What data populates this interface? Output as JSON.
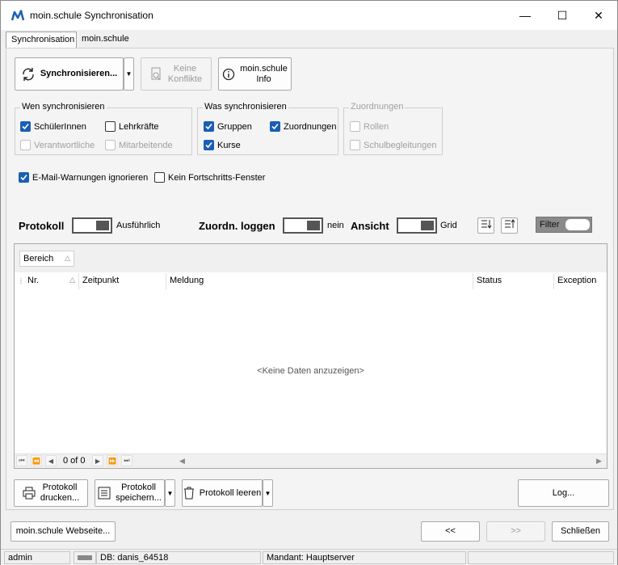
{
  "window": {
    "title": "moin.schule Synchronisation",
    "minimize_glyph": "—",
    "maximize_glyph": "☐",
    "close_glyph": "✕"
  },
  "tabs": [
    {
      "label": "Synchronisation",
      "active": true
    },
    {
      "label": "moin.schule",
      "active": false
    }
  ],
  "toolbar": {
    "sync_label": "Synchronisieren...",
    "conflicts_line1": "Keine",
    "conflicts_line2": "Konflikte",
    "info_line1": "moin.schule",
    "info_line2": "Info"
  },
  "groups": {
    "wen": {
      "title": "Wen synchronisieren",
      "items": [
        {
          "label": "SchülerInnen",
          "checked": true,
          "enabled": true
        },
        {
          "label": "Lehrkräfte",
          "checked": false,
          "enabled": true
        },
        {
          "label": "Verantwortliche",
          "checked": false,
          "enabled": false
        },
        {
          "label": "Mitarbeitende",
          "checked": false,
          "enabled": false
        }
      ]
    },
    "was": {
      "title": "Was synchronisieren",
      "items": [
        {
          "label": "Gruppen",
          "checked": true,
          "enabled": true
        },
        {
          "label": "Zuordnungen",
          "checked": true,
          "enabled": true
        },
        {
          "label": "Kurse",
          "checked": true,
          "enabled": true
        }
      ]
    },
    "zuordnungen": {
      "title": "Zuordnungen",
      "items": [
        {
          "label": "Rollen",
          "checked": false,
          "enabled": false
        },
        {
          "label": "Schulbegleitungen",
          "checked": false,
          "enabled": false
        }
      ]
    }
  },
  "options": {
    "ignore_email_warnings": {
      "label": "E-Mail-Warnungen ignorieren",
      "checked": true
    },
    "no_progress_window": {
      "label": "Kein Fortschritts-Fenster",
      "checked": false
    }
  },
  "toggles": {
    "protokoll": {
      "label": "Protokoll",
      "value": "Ausführlich"
    },
    "zuordn": {
      "label": "Zuordn. loggen",
      "value": "nein"
    },
    "ansicht": {
      "label": "Ansicht",
      "value": "Grid"
    },
    "filter": {
      "label": "Filter"
    }
  },
  "grid": {
    "group_by": "Bereich",
    "columns": [
      "Nr.",
      "Zeitpunkt",
      "Meldung",
      "Status",
      "Exception"
    ],
    "empty_message": "<Keine Daten anzuzeigen>",
    "record_indicator": "0 of 0"
  },
  "bottom_buttons": {
    "print_line1": "Protokoll",
    "print_line2": "drucken...",
    "save_line1": "Protokoll",
    "save_line2": "speichern...",
    "clear_label": "Protokoll leeren",
    "log_label": "Log..."
  },
  "footer": {
    "website_label": "moin.schule Webseite...",
    "back_label": "<<",
    "forward_label": ">>",
    "close_label": "Schließen"
  },
  "statusbar": {
    "user": "admin",
    "db": "DB: danis_64518",
    "mandant": "Mandant: Hauptserver"
  },
  "colors": {
    "accent": "#1a5fb4",
    "filter_bg": "#8a8a8a"
  }
}
